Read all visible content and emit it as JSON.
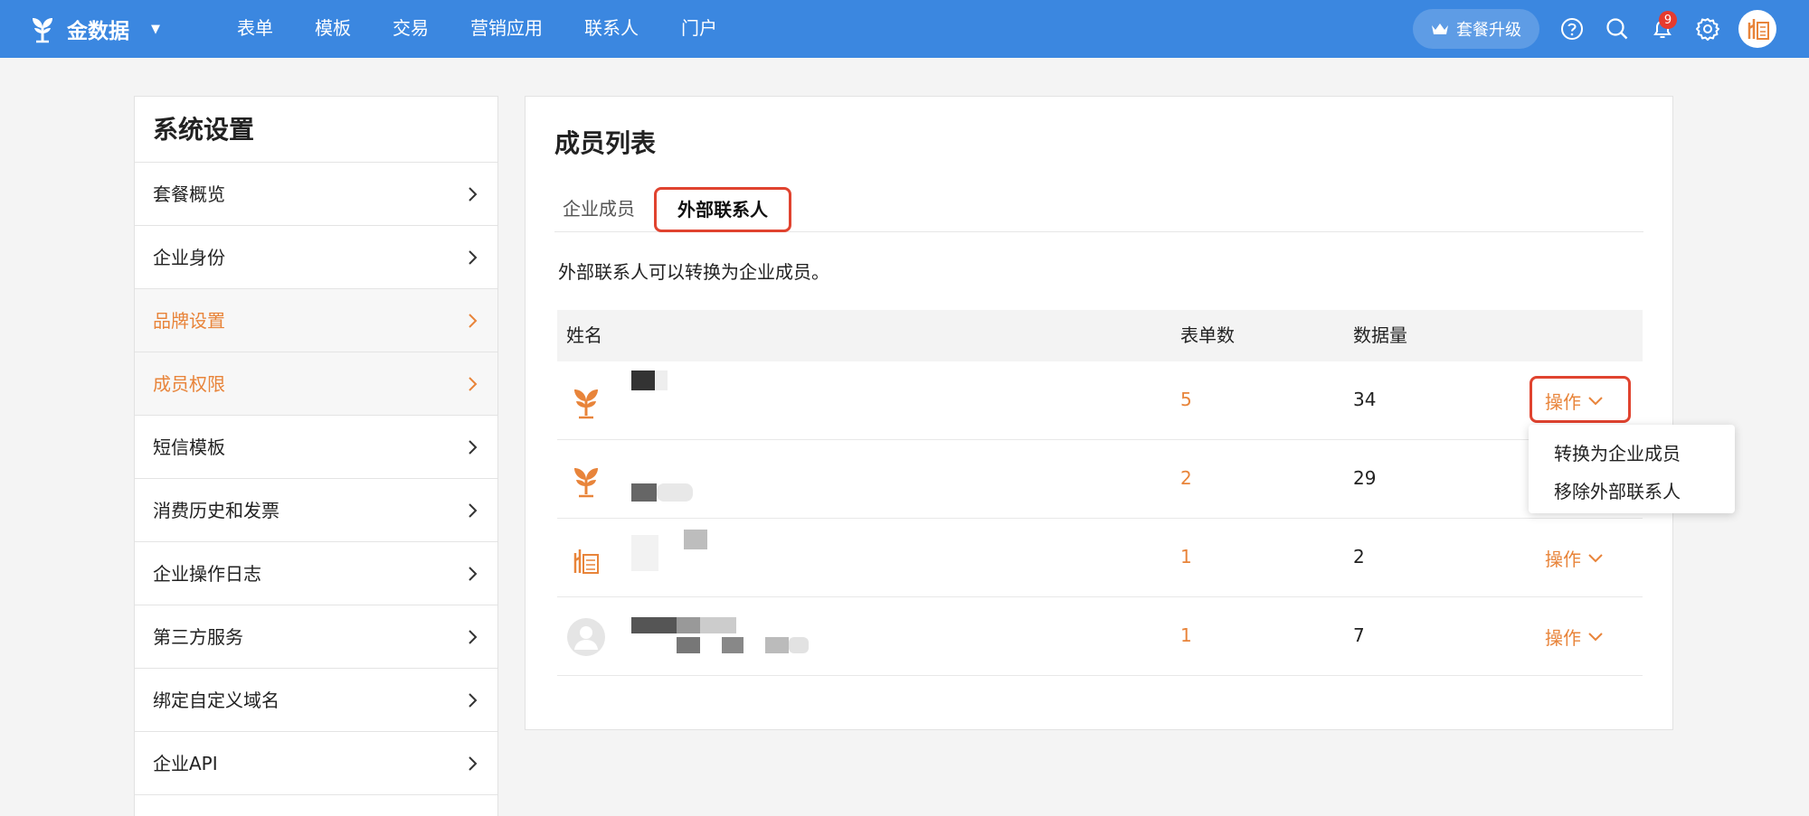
{
  "topbar": {
    "brand": "金数据",
    "nav": [
      "表单",
      "模板",
      "交易",
      "营销应用",
      "联系人",
      "门户"
    ],
    "upgrade_label": "套餐升级",
    "notification_count": "9",
    "icons": [
      "help-icon",
      "search-icon",
      "bell-icon",
      "gear-icon"
    ],
    "color": "#3b87e0"
  },
  "sidebar": {
    "title": "系统设置",
    "items": [
      {
        "label": "套餐概览",
        "active": false
      },
      {
        "label": "企业身份",
        "active": false
      },
      {
        "label": "品牌设置",
        "active": true
      },
      {
        "label": "成员权限",
        "active": true
      },
      {
        "label": "短信模板",
        "active": false
      },
      {
        "label": "消费历史和发票",
        "active": false
      },
      {
        "label": "企业操作日志",
        "active": false
      },
      {
        "label": "第三方服务",
        "active": false
      },
      {
        "label": "绑定自定义域名",
        "active": false
      },
      {
        "label": "企业API",
        "active": false
      }
    ],
    "active_color": "#e8843a"
  },
  "main": {
    "title": "成员列表",
    "tabs": [
      {
        "label": "企业成员",
        "selected": false
      },
      {
        "label": "外部联系人",
        "selected": true
      }
    ],
    "description": "外部联系人可以转换为企业成员。",
    "columns": [
      "姓名",
      "表单数",
      "数据量"
    ],
    "rows": [
      {
        "forms": "5",
        "data": "34",
        "action": "操作"
      },
      {
        "forms": "2",
        "data": "29",
        "action": ""
      },
      {
        "forms": "1",
        "data": "2",
        "action": "操作"
      },
      {
        "forms": "1",
        "data": "7",
        "action": "操作"
      }
    ],
    "dropdown": [
      "转换为企业成员",
      "移除外部联系人"
    ],
    "highlight_color": "#e0432f"
  }
}
